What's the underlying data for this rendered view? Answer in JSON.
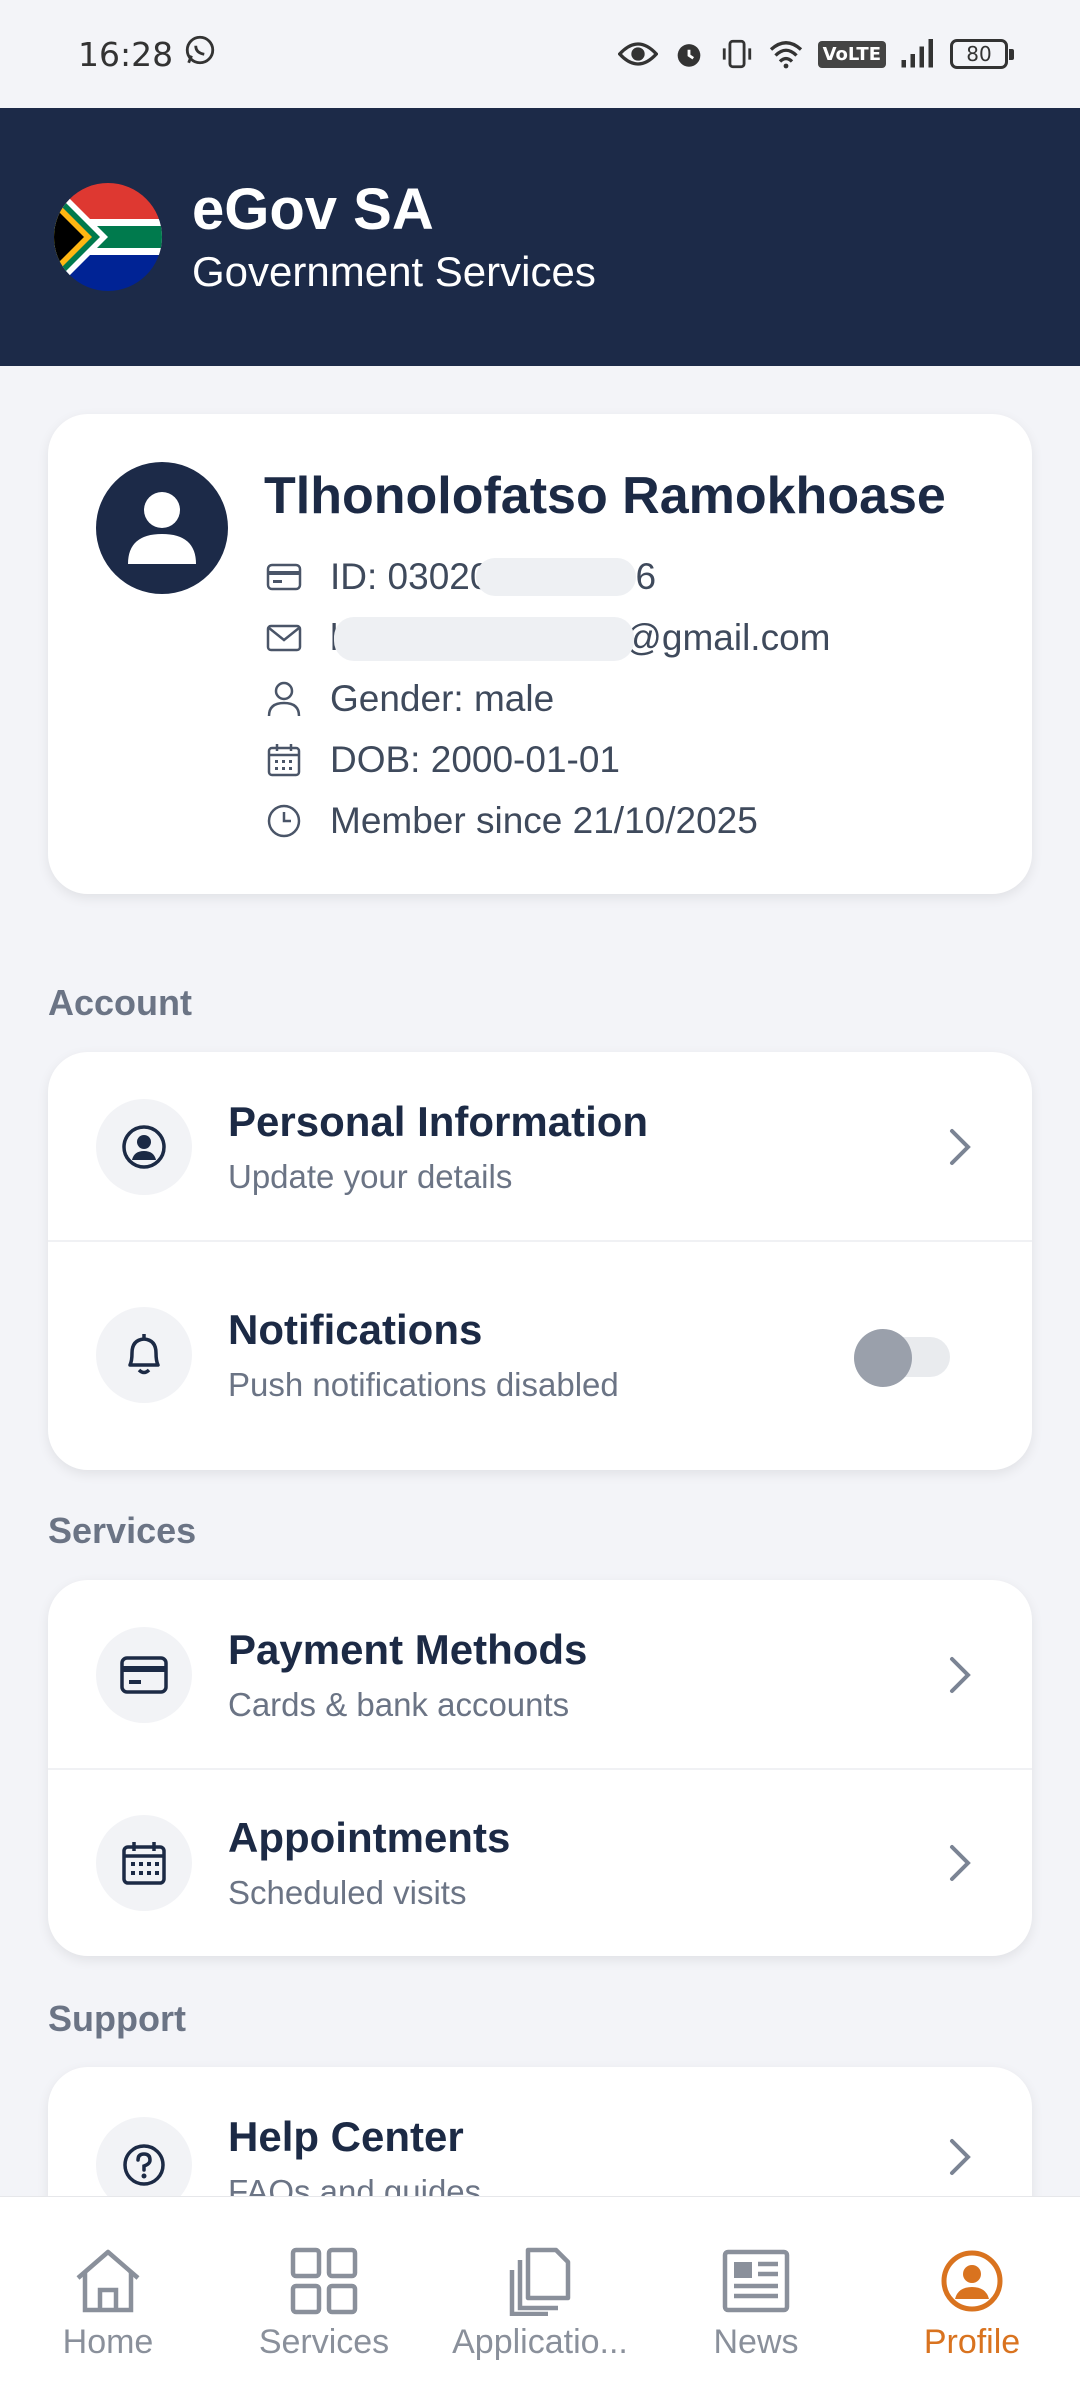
{
  "status_bar": {
    "time": "16:28",
    "icons": [
      "whatsapp-icon",
      "eye-icon",
      "alarm-icon",
      "vibrate-icon",
      "wifi-icon",
      "volte-icon",
      "signal-icon",
      "battery-icon"
    ],
    "volte": "VoLTE",
    "battery": "80"
  },
  "header": {
    "title": "eGov SA",
    "subtitle": "Government Services"
  },
  "profile": {
    "name": "Tlhonolofatso Ramokhoase",
    "id_prefix": "ID: 03020",
    "id_suffix": "6",
    "email_prefix": "l",
    "email_suffix": "se@gmail.com",
    "gender": "Gender: male",
    "dob": "DOB: 2000-01-01",
    "member_since": "Member since 21/10/2025"
  },
  "sections": {
    "account": "Account",
    "services": "Services",
    "support": "Support"
  },
  "account_items": [
    {
      "title": "Personal Information",
      "subtitle": "Update your details"
    },
    {
      "title": "Notifications",
      "subtitle": "Push notifications disabled",
      "toggle_on": false
    }
  ],
  "services_items": [
    {
      "title": "Payment Methods",
      "subtitle": "Cards & bank accounts"
    },
    {
      "title": "Appointments",
      "subtitle": "Scheduled visits"
    }
  ],
  "support_items": [
    {
      "title": "Help Center",
      "subtitle": "FAQs and guides"
    }
  ],
  "bottom_nav": [
    {
      "label": "Home",
      "icon": "home-icon"
    },
    {
      "label": "Services",
      "icon": "grid-icon"
    },
    {
      "label": "Applicatio...",
      "icon": "documents-icon"
    },
    {
      "label": "News",
      "icon": "newspaper-icon"
    },
    {
      "label": "Profile",
      "icon": "user-circle-icon",
      "active": true
    }
  ],
  "colors": {
    "header_bg": "#1c2a48",
    "accent": "#d9731f",
    "page_bg": "#f3f4f8"
  }
}
